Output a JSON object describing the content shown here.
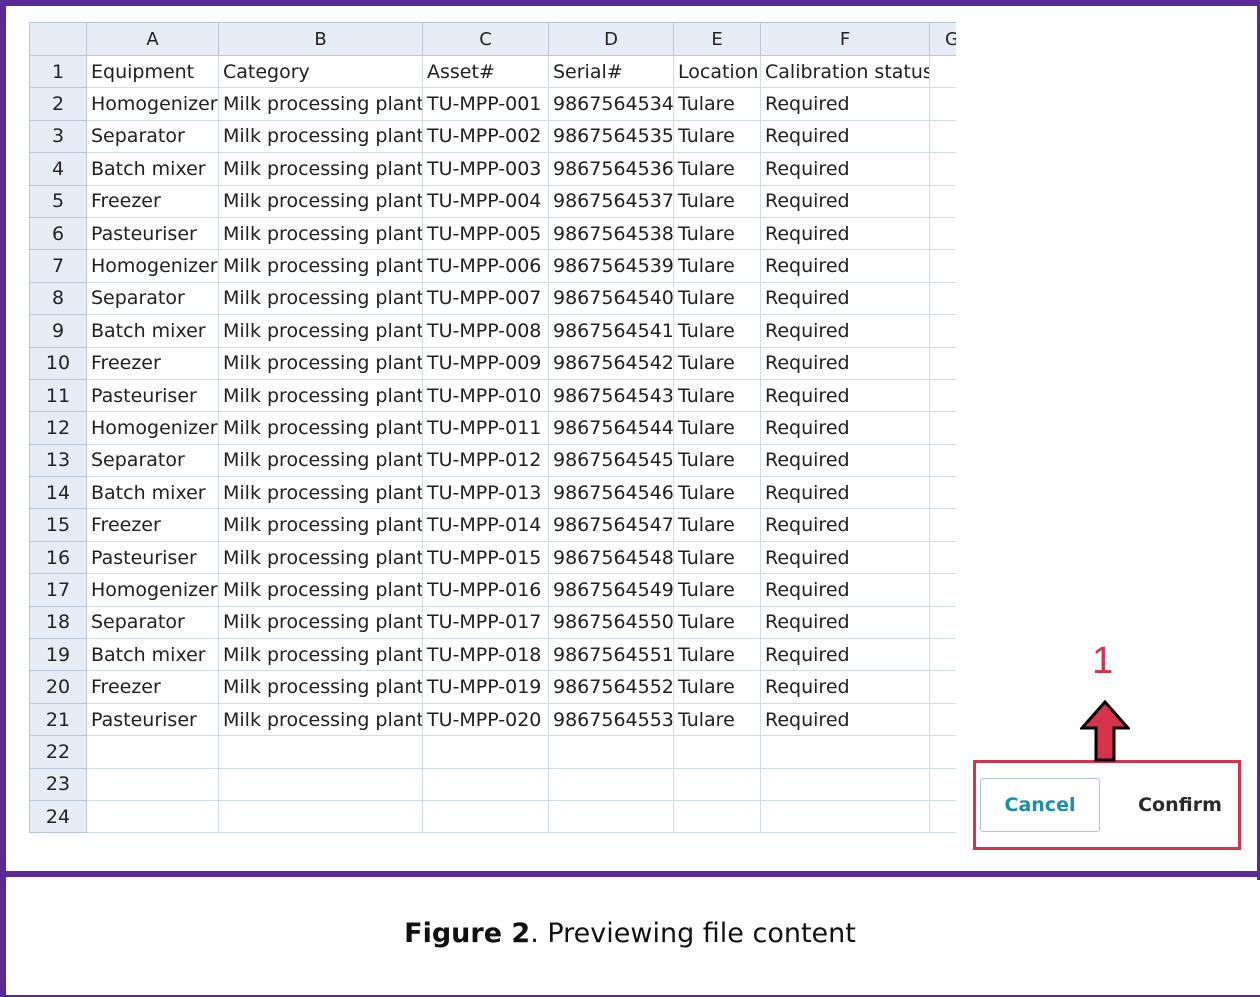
{
  "sheet": {
    "columns": [
      "A",
      "B",
      "C",
      "D",
      "E",
      "F",
      "G"
    ],
    "rows": [
      {
        "n": "1",
        "cells": [
          "Equipment",
          "Category",
          "Asset#",
          "Serial#",
          "Location",
          "Calibration status"
        ]
      },
      {
        "n": "2",
        "cells": [
          "Homogenizer",
          "Milk processing plant",
          "TU-MPP-001",
          "9867564534",
          "Tulare",
          "Required"
        ]
      },
      {
        "n": "3",
        "cells": [
          "Separator",
          "Milk processing plant",
          "TU-MPP-002",
          "9867564535",
          "Tulare",
          "Required"
        ]
      },
      {
        "n": "4",
        "cells": [
          "Batch mixer",
          "Milk processing plant",
          "TU-MPP-003",
          "9867564536",
          "Tulare",
          "Required"
        ]
      },
      {
        "n": "5",
        "cells": [
          "Freezer",
          "Milk processing plant",
          "TU-MPP-004",
          "9867564537",
          "Tulare",
          "Required"
        ]
      },
      {
        "n": "6",
        "cells": [
          "Pasteuriser",
          "Milk processing plant",
          "TU-MPP-005",
          "9867564538",
          "Tulare",
          "Required"
        ]
      },
      {
        "n": "7",
        "cells": [
          "Homogenizer",
          "Milk processing plant",
          "TU-MPP-006",
          "9867564539",
          "Tulare",
          "Required"
        ]
      },
      {
        "n": "8",
        "cells": [
          "Separator",
          "Milk processing plant",
          "TU-MPP-007",
          "9867564540",
          "Tulare",
          "Required"
        ]
      },
      {
        "n": "9",
        "cells": [
          "Batch mixer",
          "Milk processing plant",
          "TU-MPP-008",
          "9867564541",
          "Tulare",
          "Required"
        ]
      },
      {
        "n": "10",
        "cells": [
          "Freezer",
          "Milk processing plant",
          "TU-MPP-009",
          "9867564542",
          "Tulare",
          "Required"
        ]
      },
      {
        "n": "11",
        "cells": [
          "Pasteuriser",
          "Milk processing plant",
          "TU-MPP-010",
          "9867564543",
          "Tulare",
          "Required"
        ]
      },
      {
        "n": "12",
        "cells": [
          "Homogenizer",
          "Milk processing plant",
          "TU-MPP-011",
          "9867564544",
          "Tulare",
          "Required"
        ]
      },
      {
        "n": "13",
        "cells": [
          "Separator",
          "Milk processing plant",
          "TU-MPP-012",
          "9867564545",
          "Tulare",
          "Required"
        ]
      },
      {
        "n": "14",
        "cells": [
          "Batch mixer",
          "Milk processing plant",
          "TU-MPP-013",
          "9867564546",
          "Tulare",
          "Required"
        ]
      },
      {
        "n": "15",
        "cells": [
          "Freezer",
          "Milk processing plant",
          "TU-MPP-014",
          "9867564547",
          "Tulare",
          "Required"
        ]
      },
      {
        "n": "16",
        "cells": [
          "Pasteuriser",
          "Milk processing plant",
          "TU-MPP-015",
          "9867564548",
          "Tulare",
          "Required"
        ]
      },
      {
        "n": "17",
        "cells": [
          "Homogenizer",
          "Milk processing plant",
          "TU-MPP-016",
          "9867564549",
          "Tulare",
          "Required"
        ]
      },
      {
        "n": "18",
        "cells": [
          "Separator",
          "Milk processing plant",
          "TU-MPP-017",
          "9867564550",
          "Tulare",
          "Required"
        ]
      },
      {
        "n": "19",
        "cells": [
          "Batch mixer",
          "Milk processing plant",
          "TU-MPP-018",
          "9867564551",
          "Tulare",
          "Required"
        ]
      },
      {
        "n": "20",
        "cells": [
          "Freezer",
          "Milk processing plant",
          "TU-MPP-019",
          "9867564552",
          "Tulare",
          "Required"
        ]
      },
      {
        "n": "21",
        "cells": [
          "Pasteuriser",
          "Milk processing plant",
          "TU-MPP-020",
          "9867564553",
          "Tulare",
          "Required"
        ]
      },
      {
        "n": "22",
        "cells": [
          "",
          "",
          "",
          "",
          "",
          ""
        ]
      },
      {
        "n": "23",
        "cells": [
          "",
          "",
          "",
          "",
          "",
          ""
        ]
      },
      {
        "n": "24",
        "cells": [
          "",
          "",
          "",
          "",
          "",
          ""
        ]
      }
    ]
  },
  "actions": {
    "cancel_label": "Cancel",
    "confirm_label": "Confirm"
  },
  "annotation": {
    "step_number": "1",
    "color": "#d6334a"
  },
  "caption": {
    "label": "Figure 2",
    "text": ". Previewing file content"
  },
  "colors": {
    "frame": "#5b2a9a",
    "cancel_text": "#1a8fa8",
    "header_bg": "#e6edf6"
  }
}
